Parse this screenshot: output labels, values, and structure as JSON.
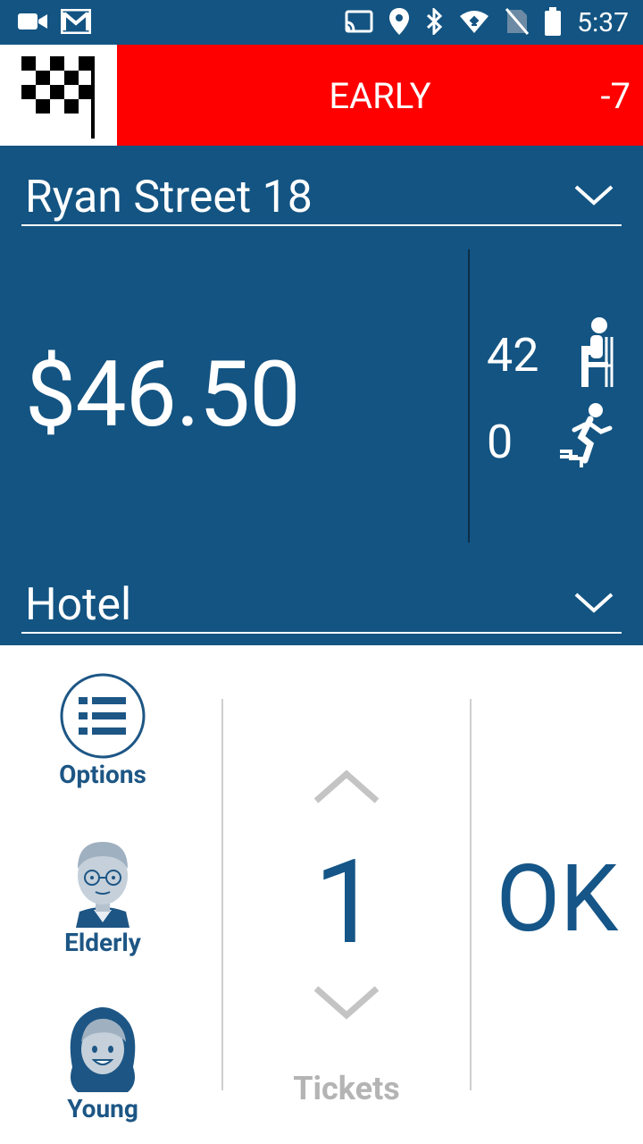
{
  "status_bar": {
    "time": "5:37",
    "left_icons": [
      "video-icon",
      "gmail-icon"
    ],
    "right_icons": [
      "cast-icon",
      "location-icon",
      "bluetooth-icon",
      "wifi-icon",
      "no-sim-icon",
      "battery-icon"
    ]
  },
  "header": {
    "status_label": "EARLY",
    "status_delta": "-7",
    "status_color": "#fe0000",
    "flag_icon": "checkered-flag-icon"
  },
  "trip": {
    "current_stop": "Ryan Street 18",
    "fare": "$46.50",
    "seated_count": "42",
    "boarding_count": "0",
    "destination": "Hotel",
    "panel_color": "#135482"
  },
  "controls": {
    "options_label": "Options",
    "elderly_label": "Elderly",
    "young_label": "Young",
    "ticket_count": "1",
    "tickets_label": "Tickets",
    "ok_label": "OK",
    "accent_color": "#155587"
  }
}
